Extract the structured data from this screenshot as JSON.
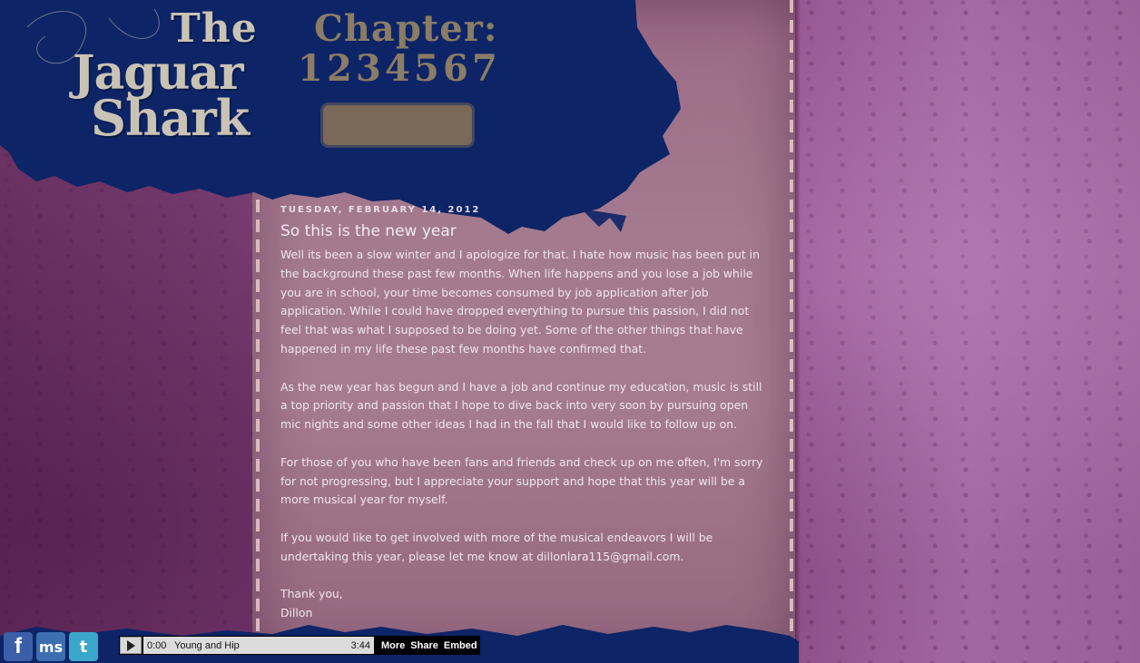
{
  "header": {
    "logo": {
      "line1": "The",
      "line2": "Jaguar",
      "line3": "Shark"
    },
    "chapter_label": "Chapter:",
    "chapters": [
      "1",
      "2",
      "3",
      "4",
      "5",
      "6",
      "7"
    ]
  },
  "post": {
    "date": "TUESDAY, FEBRUARY 14, 2012",
    "title": "So this is the new year",
    "paragraphs": [
      "Well its been a slow winter and I apologize for that.  I hate how music has been put in the background these past few months.  When life happens and you lose a job while you are in school, your time becomes consumed by job application after job application.  While I could have dropped everything to pursue this passion, I did not feel that was what I supposed to be doing yet.  Some of the other things that have happened in my life these past few months have confirmed that.",
      "As the new year has begun and I have a job and continue my education, music is still a top priority and passion that I hope to dive back into very soon by pursuing open mic nights and some other ideas I had in the fall that I would like to follow up on.",
      "For those of you who have been fans and friends and check up on me often, I'm sorry for not progressing, but I appreciate your support and hope that this year will be a more musical year for myself.",
      "If you would like to get involved with more of the musical endeavors I will be undertaking this year, please let me know at dillonlara115@gmail.com."
    ],
    "signoff": "Thank you,",
    "signature": "Dillon"
  },
  "social": {
    "facebook": "f",
    "myspace": "ms",
    "twitter": "t"
  },
  "player": {
    "current_time": "0:00",
    "track_title": "Young and Hip",
    "duration": "3:44",
    "links": [
      "More",
      "Share",
      "Embed"
    ]
  },
  "colors": {
    "navy": "#0d2466",
    "purple": "#8a4f86",
    "paper": "#a47a8f",
    "tan": "#8a7c66"
  }
}
